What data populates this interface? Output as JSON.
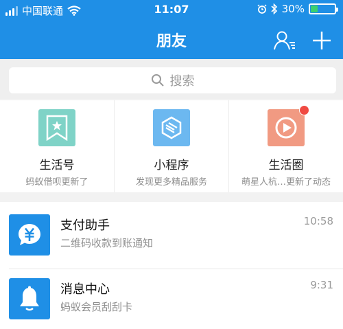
{
  "status_bar": {
    "carrier": "中国联通",
    "time": "11:07",
    "battery_percent": "30%",
    "battery_level": 0.3
  },
  "nav": {
    "title": "朋友",
    "contacts_icon": "contacts-icon",
    "add_icon": "plus-icon"
  },
  "search": {
    "placeholder": "搜索"
  },
  "shortcuts": [
    {
      "title": "生活号",
      "subtitle": "蚂蚁借呗更新了",
      "icon": "bookmark-star-icon",
      "color": "#7fd3c7"
    },
    {
      "title": "小程序",
      "subtitle": "发现更多精品服务",
      "icon": "mini-program-icon",
      "color": "#6cb8f0"
    },
    {
      "title": "生活圈",
      "subtitle": "萌星人杭…更新了动态",
      "icon": "play-circle-icon",
      "color": "#f19a82",
      "has_badge": true
    }
  ],
  "messages": [
    {
      "title": "支付助手",
      "subtitle": "二维码收款到账通知",
      "time": "10:58",
      "icon": "yuan-bubble-icon"
    },
    {
      "title": "消息中心",
      "subtitle": "蚂蚁会员刮刮卡",
      "time": "9:31",
      "icon": "bell-icon"
    }
  ],
  "colors": {
    "primary": "#1f8fe6",
    "badge": "#f04a42",
    "battery": "#3bd16f"
  }
}
